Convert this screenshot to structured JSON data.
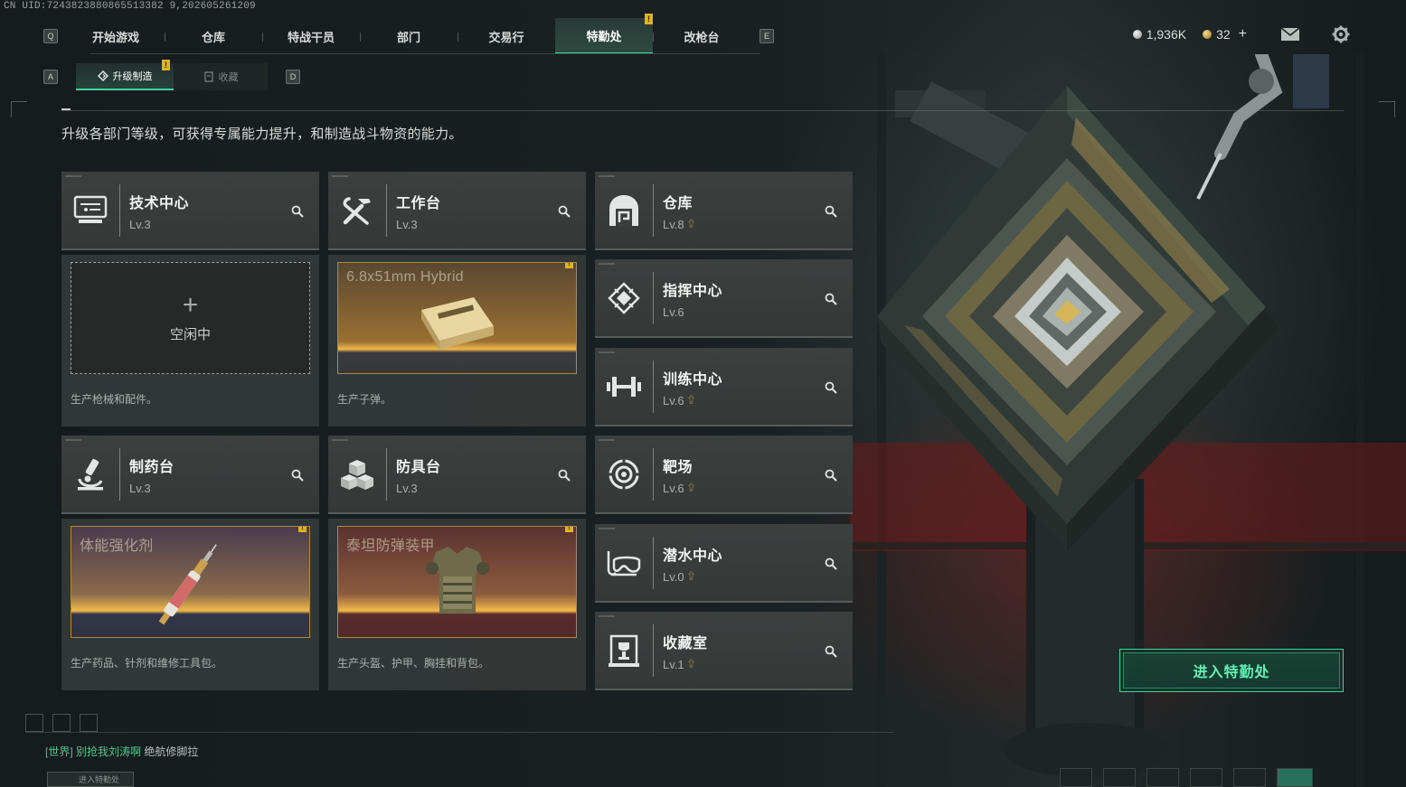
{
  "uid_text": "CN UID:7243823880865513382 9,202605261209",
  "nav": {
    "left_key": "Q",
    "right_key": "E",
    "tabs": [
      {
        "label": "开始游戏",
        "active": false,
        "badge": ""
      },
      {
        "label": "仓库",
        "active": false,
        "badge": ""
      },
      {
        "label": "特战干员",
        "active": false,
        "badge": ""
      },
      {
        "label": "部门",
        "active": false,
        "badge": ""
      },
      {
        "label": "交易行",
        "active": false,
        "badge": ""
      },
      {
        "label": "特勤处",
        "active": true,
        "badge": "!"
      },
      {
        "label": "改枪台",
        "active": false,
        "badge": ""
      }
    ]
  },
  "currency": {
    "silver": "1,936K",
    "gold": "32",
    "plus": "+"
  },
  "top_icons": [
    "mail-icon",
    "gear-icon"
  ],
  "subnav": {
    "left_key": "A",
    "right_key": "D",
    "tabs": [
      {
        "label": "升级制造",
        "active": true,
        "badge": "!"
      },
      {
        "label": "收藏",
        "active": false,
        "badge": ""
      }
    ]
  },
  "description": "升级各部门等级，可获得专属能力提升，和制造战斗物资的能力。",
  "production": [
    {
      "name": "技术中心",
      "level": "Lv.3",
      "icon": "computer-icon",
      "upgrade": false,
      "slot": {
        "state": "idle",
        "plus": "+",
        "idle_label": "空闲中"
      },
      "desc": "生产枪械和配件。"
    },
    {
      "name": "工作台",
      "level": "Lv.3",
      "icon": "tools-icon",
      "upgrade": false,
      "slot": {
        "state": "item",
        "item_name": "6.8x51mm Hybrid",
        "badge": "!",
        "theme": "ammo"
      },
      "desc": "生产子弹。"
    },
    {
      "name": "制药台",
      "level": "Lv.3",
      "icon": "microscope-icon",
      "upgrade": false,
      "slot": {
        "state": "item",
        "item_name": "体能强化剂",
        "badge": "!",
        "theme": "syringe"
      },
      "desc": "生产药品、针剂和维修工具包。"
    },
    {
      "name": "防具台",
      "level": "Lv.3",
      "icon": "armor-cubes-icon",
      "upgrade": false,
      "slot": {
        "state": "item",
        "item_name": "泰坦防弹装甲",
        "badge": "!",
        "theme": "armor"
      },
      "desc": "生产头盔、护甲、胸挂和背包。"
    }
  ],
  "departments": [
    {
      "name": "仓库",
      "level": "Lv.8",
      "icon": "vault-icon",
      "upgrade": true
    },
    {
      "name": "指挥中心",
      "level": "Lv.6",
      "icon": "command-chip-icon",
      "upgrade": false
    },
    {
      "name": "训练中心",
      "level": "Lv.6",
      "icon": "dumbbell-icon",
      "upgrade": true
    },
    {
      "name": "靶场",
      "level": "Lv.6",
      "icon": "target-icon",
      "upgrade": true
    },
    {
      "name": "潜水中心",
      "level": "Lv.0",
      "icon": "diving-mask-icon",
      "upgrade": true
    },
    {
      "name": "收藏室",
      "level": "Lv.1",
      "icon": "trophy-case-icon",
      "upgrade": true
    }
  ],
  "enter_button": "进入特勤处",
  "chat": {
    "channel": "[世界]",
    "name": "别抢我刘涛啊",
    "message": "绝航修脚拉"
  },
  "bottom_button": "进入特勤处",
  "colors": {
    "accent": "#3fd49a",
    "badge": "#e0b420",
    "upgrade_arrow": "#d8ad3c",
    "card_bg": "#3b403f"
  }
}
